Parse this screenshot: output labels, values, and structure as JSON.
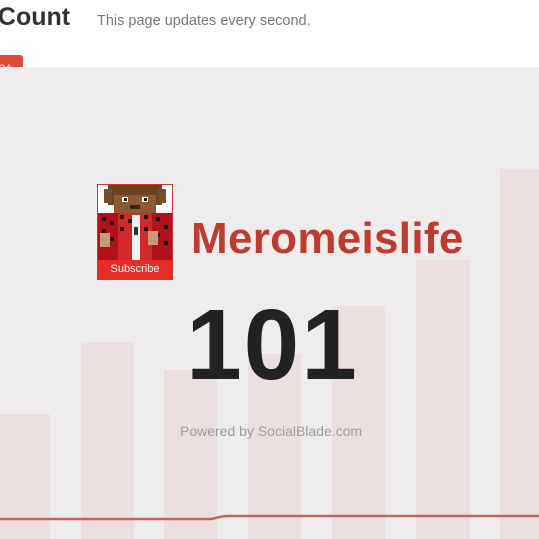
{
  "header": {
    "title": "Count",
    "subtitle": "This page updates every second.",
    "gplus_label": "le+"
  },
  "channel": {
    "name": "Meromeislife",
    "subscribe_label": "Subscribe",
    "subscriber_count": "101"
  },
  "footer": {
    "powered_by": "Powered by SocialBlade.com"
  },
  "colors": {
    "accent": "#bf3a2f",
    "subscribe": "#e52d27",
    "gplus": "#dd4b39",
    "background": "#eeecec",
    "bar": "#ecdfdf",
    "trend_line": "#c6625c"
  },
  "icons": [
    "minecraft-avatar-image"
  ]
}
